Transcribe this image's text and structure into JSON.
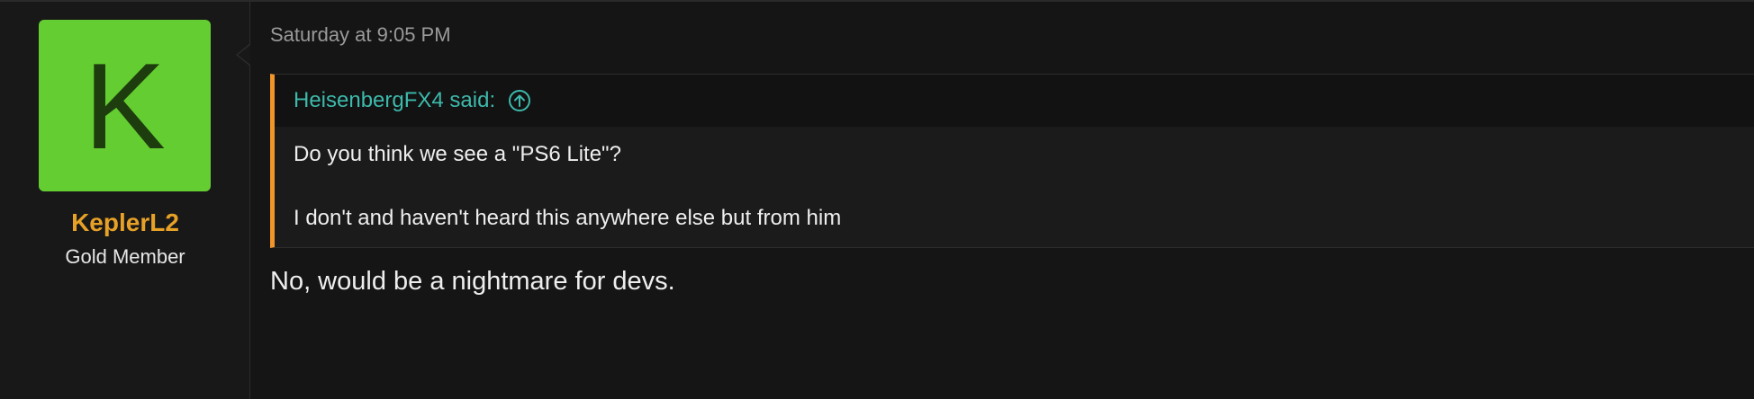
{
  "user": {
    "avatar_letter": "K",
    "avatar_color": "#64cd31",
    "username": "KeplerL2",
    "username_color": "#e6a126",
    "title": "Gold Member"
  },
  "post": {
    "timestamp": "Saturday at 9:05 PM",
    "quote": {
      "author": "HeisenbergFX4 said:",
      "jump_icon": "arrow-up-circle-icon",
      "lines": [
        "Do you think we see a \"PS6 Lite\"?",
        "I don't and haven't heard this anywhere else but from him"
      ],
      "accent_color": "#f0952a",
      "author_color": "#3db9ab"
    },
    "body": "No, would be a nightmare for devs."
  }
}
